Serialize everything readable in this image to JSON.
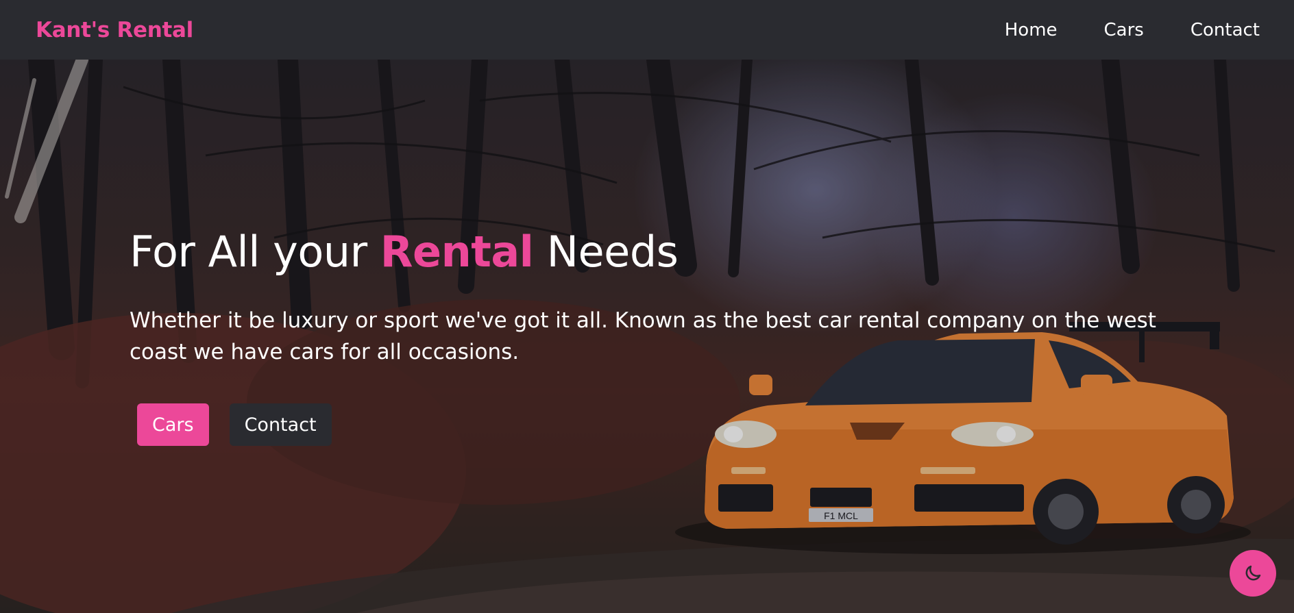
{
  "navbar": {
    "brand": "Kant's Rental",
    "links": [
      {
        "label": "Home"
      },
      {
        "label": "Cars"
      },
      {
        "label": "Contact"
      }
    ]
  },
  "hero": {
    "headline_before": "For All your ",
    "headline_accent": "Rental",
    "headline_after": " Needs",
    "tagline": "Whether it be luxury or sport we've got it all. Known as the best car rental company on the west coast we have cars for all occasions.",
    "buttons": {
      "primary_label": "Cars",
      "secondary_label": "Contact"
    },
    "image": {
      "plate_text": "F1 MCL"
    }
  },
  "theme_toggle": {
    "icon": "moon-icon"
  },
  "colors": {
    "accent": "#ec4899",
    "navbar_bg": "#2a2b30",
    "car_orange": "#f08a3c"
  }
}
